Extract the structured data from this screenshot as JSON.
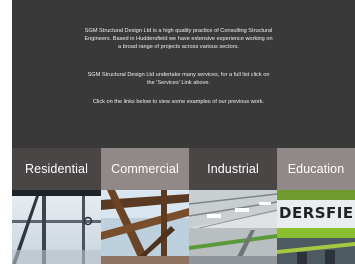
{
  "intro": {
    "paragraph1": "SGM Structural Design Ltd is a high quality practice of Consulting Structural Engineers. Based in Huddersfield we have extensive experience working on a broad range of projects across various sectors.",
    "paragraph2": "SGM Structural Design Ltd undertake many services, for a full list click on the 'Services' Link above.",
    "paragraph3": "Click on the links below to view some examples of our previous work."
  },
  "sectors": [
    {
      "label": "Residential"
    },
    {
      "label": "Commercial"
    },
    {
      "label": "Industrial"
    },
    {
      "label": "Education"
    }
  ],
  "photos": {
    "education_sign": "DERSFIELD"
  },
  "colors": {
    "intro_bg": "#3a3939",
    "tab_dark": "#4b4646",
    "tab_light": "#918987"
  }
}
